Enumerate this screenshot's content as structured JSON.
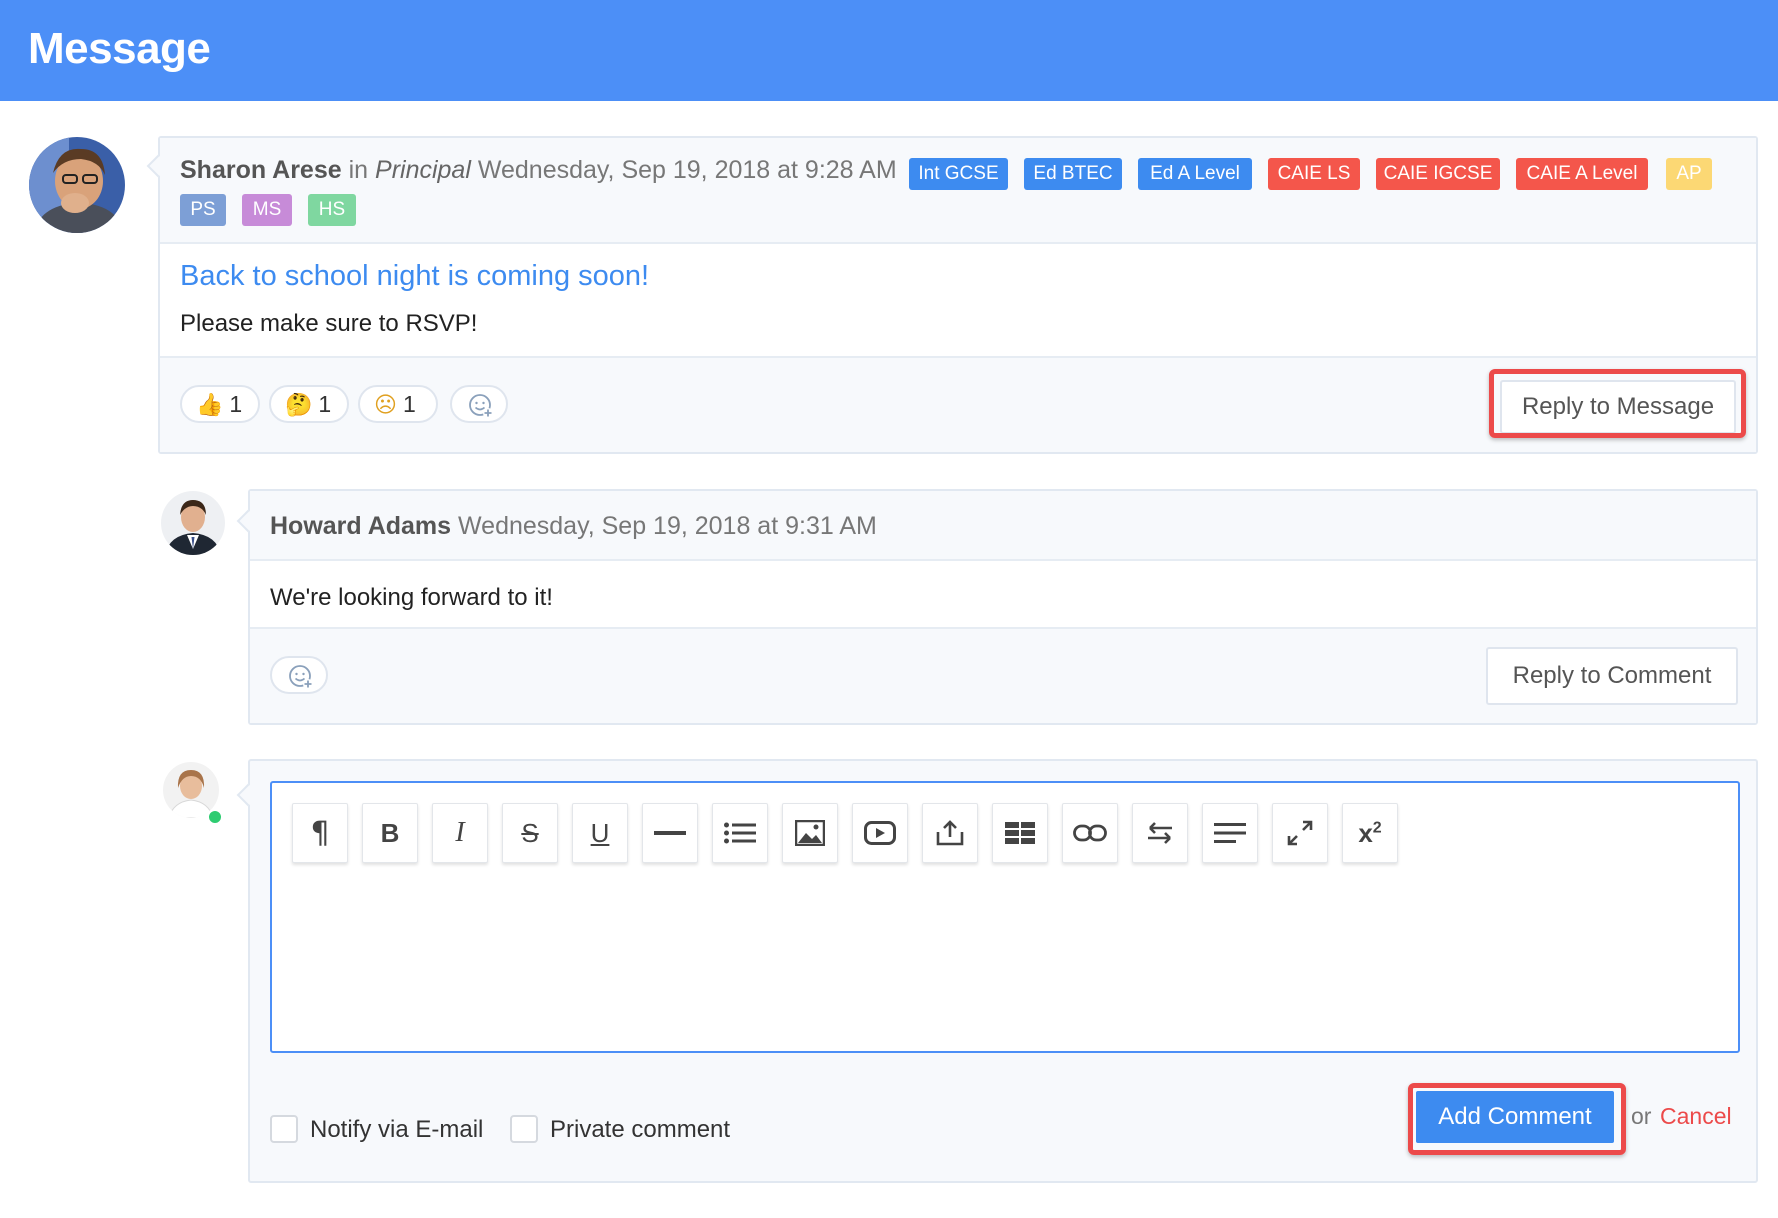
{
  "header": {
    "title": "Message"
  },
  "message": {
    "author": "Sharon Arese",
    "in_word": "in",
    "role": "Principal",
    "timestamp": "Wednesday, Sep 19, 2018 at 9:28 AM",
    "tags": [
      {
        "label": "Int GCSE",
        "color": "#3d8bf0"
      },
      {
        "label": "Ed BTEC",
        "color": "#3d8bf0"
      },
      {
        "label": "Ed A Level",
        "color": "#3d8bf0"
      },
      {
        "label": "CAIE LS",
        "color": "#f4564b"
      },
      {
        "label": "CAIE IGCSE",
        "color": "#f4564b"
      },
      {
        "label": "CAIE A Level",
        "color": "#f4564b"
      },
      {
        "label": "AP",
        "color": "#fcd874"
      },
      {
        "label": "PS",
        "color": "#7d9fd6"
      },
      {
        "label": "MS",
        "color": "#c78bd8"
      },
      {
        "label": "HS",
        "color": "#7fd7a0"
      }
    ],
    "subject": "Back to school night is coming soon!",
    "body": "Please make sure to RSVP!",
    "reactions": [
      {
        "emoji": "👍",
        "count": "1",
        "icon": "thumbs-up-icon"
      },
      {
        "emoji": "🤔",
        "count": "1",
        "icon": "thinking-face-icon"
      },
      {
        "emoji": "☹",
        "count": "1",
        "icon": "frowning-face-icon"
      }
    ],
    "reply_label": "Reply to Message"
  },
  "comment": {
    "author": "Howard Adams",
    "timestamp": "Wednesday, Sep 19, 2018 at 9:31 AM",
    "body": "We're looking forward to it!",
    "reply_label": "Reply to Comment"
  },
  "composer": {
    "toolbar": [
      "paragraph",
      "bold",
      "italic",
      "strikethrough",
      "underline",
      "horizontal-rule",
      "list",
      "image",
      "video",
      "upload",
      "table",
      "link",
      "direction",
      "align",
      "fullscreen",
      "superscript"
    ],
    "notify_label": "Notify via E-mail",
    "private_label": "Private comment",
    "submit_label": "Add Comment",
    "or_label": "or",
    "cancel_label": "Cancel"
  },
  "colors": {
    "accent": "#4c8ff7",
    "highlight": "#ec4a4a",
    "online": "#2ecc71"
  }
}
